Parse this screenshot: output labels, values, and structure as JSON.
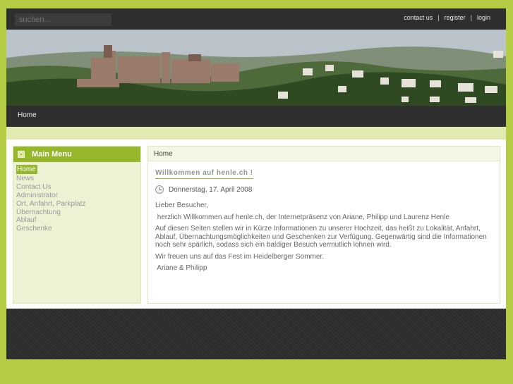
{
  "search": {
    "placeholder": "suchen..."
  },
  "toplinks": {
    "contact": "contact us",
    "sep1": "|",
    "register": "register",
    "sep2": "|",
    "login": "login"
  },
  "nav": {
    "home": "Home"
  },
  "sidebar": {
    "title": "Main Menu",
    "items": [
      {
        "label": "Home"
      },
      {
        "label": "News"
      },
      {
        "label": "Contact Us"
      },
      {
        "label": "Administrator"
      },
      {
        "label": "Ort, Anfahrt, Parkplatz"
      },
      {
        "label": "Übernachtung"
      },
      {
        "label": "Ablauf"
      },
      {
        "label": "Geschenke"
      }
    ]
  },
  "content": {
    "breadcrumb": "Home",
    "title": "Willkommen auf henle.ch !",
    "date": "Donnerstag, 17. April 2008",
    "paragraphs": [
      "Lieber Besucher,",
      " herzlich Willkommen auf henle.ch, der Internetpräsenz von Ariane, Philipp und Laurenz Henle",
      "Auf diesen Seiten stellen wir in Kürze Informationen zu unserer Hochzeit, das heißt zu Lokalität, Anfahrt, Ablauf, Übernachtungsmöglichkeiten und Geschenken zur Verfügung. Gegenwärtig sind die Informationen noch sehr spärlich, sodass sich ein baldiger Besuch vermutlich lohnen wird.",
      "Wir freuen uns auf das Fest im Heidelberger Sommer.",
      " Ariane & Philipp"
    ]
  },
  "colors": {
    "accent": "#96b72c",
    "background": "#b5cc45",
    "dark": "#2e2e2e"
  }
}
